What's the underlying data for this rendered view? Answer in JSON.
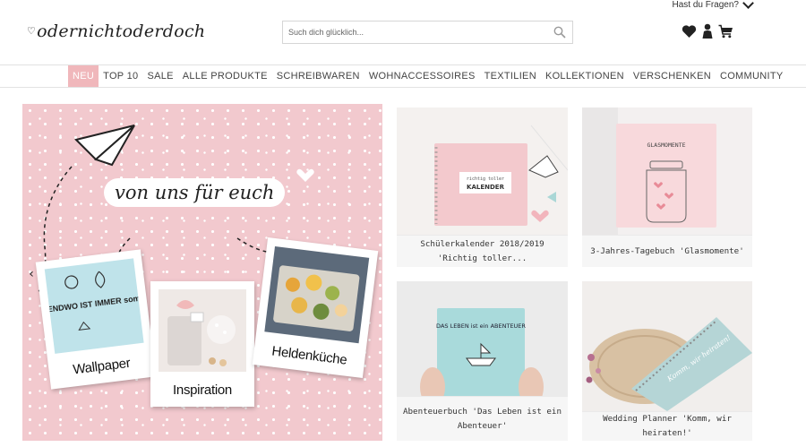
{
  "header": {
    "help_label": "Hast du Fragen?",
    "logo_text": "odernichtoderdoch",
    "search_placeholder": "Such dich glücklich...",
    "icons": [
      "heart-icon",
      "user-icon",
      "cart-icon"
    ]
  },
  "nav": {
    "items": [
      "NEU",
      "TOP 10",
      "SALE",
      "ALLE PRODUKTE",
      "SCHREIBWAREN",
      "WOHNACCESSOIRES",
      "TEXTILIEN",
      "KOLLEKTIONEN",
      "VERSCHENKEN",
      "COMMUNITY"
    ],
    "active_item": "NEU",
    "active_color": "#f0b7bb"
  },
  "hero": {
    "slogan": "von uns für euch",
    "background_color": "#f2c9ce",
    "cards": [
      {
        "caption": "Wallpaper",
        "image_text": "IRGENDWO IST IMMER sommer"
      },
      {
        "caption": "Inspiration"
      },
      {
        "caption": "Heldenküche"
      }
    ],
    "prev_arrow": "‹",
    "next_arrow": "›"
  },
  "products": [
    {
      "name": "Schülerkalender 2018/2019 'Richtig toller...",
      "cover_line1": "richtig toller",
      "cover_line2": "KALENDER"
    },
    {
      "name": "3-Jahres-Tagebuch 'Glasmomente'",
      "cover_line1": "GLASMOMENTE"
    },
    {
      "name": "Abenteuerbuch 'Das Leben ist ein Abenteuer'",
      "cover_line1": "DAS LEBEN ist ein ABENTEUER"
    },
    {
      "name": "Wedding Planner 'Komm, wir heiraten!'",
      "cover_line1": "Komm, wir heiraten!"
    }
  ]
}
